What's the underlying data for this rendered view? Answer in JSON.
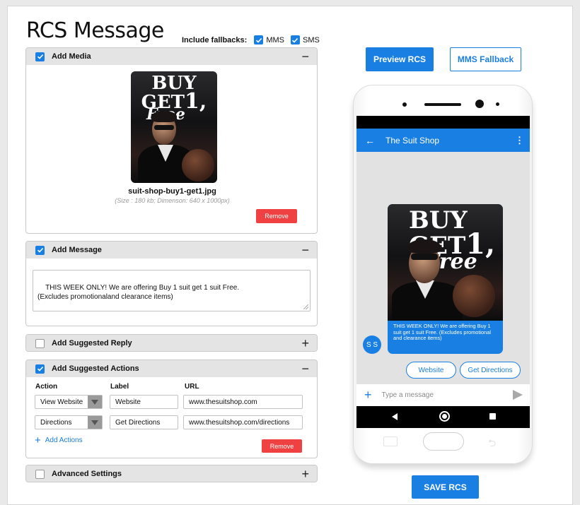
{
  "title": "RCS Message",
  "fallbacks": {
    "label": "Include fallbacks:",
    "mms": "MMS",
    "sms": "SMS"
  },
  "media": {
    "header": "Add Media",
    "toggle": "−",
    "filename": "suit-shop-buy1-get1.jpg",
    "filesize": "(Size : 180 kb; Dimenson: 640 x 1000px)",
    "remove": "Remove",
    "poster_line1": "BUY",
    "poster_line2": "GET",
    "poster_num": "1,",
    "poster_free": "Free"
  },
  "message": {
    "header": "Add Message",
    "toggle": "−",
    "text": "THIS WEEK ONLY! We are offering Buy 1 suit get 1 suit Free.\n(Excludes promotionaland clearance items)"
  },
  "suggested_reply": {
    "header": "Add Suggested Reply",
    "toggle": "+"
  },
  "suggested_actions": {
    "header": "Add Suggested Actions",
    "toggle": "−",
    "col_action": "Action",
    "col_label": "Label",
    "col_url": "URL",
    "rows": [
      {
        "action": "View Website",
        "label": "Website",
        "url": "www.thesuitshop.com"
      },
      {
        "action": "Directions",
        "label": "Get Directions",
        "url": "www.thesuitshop.com/directions"
      }
    ],
    "add_actions": "Add Actions",
    "remove": "Remove"
  },
  "advanced": {
    "header": "Advanced Settings",
    "toggle": "+"
  },
  "preview_rcs": "Preview RCS",
  "mms_fallback": "MMS Fallback",
  "save_rcs": "SAVE RCS",
  "phone": {
    "contact": "The Suit Shop",
    "bubble_text": "THIS WEEK ONLY! We are offering Buy 1 suit get 1 suit Free. (Excludes promotional and clearance items)",
    "avatar": "S S",
    "chip_website": "Website",
    "chip_directions": "Get Directions",
    "composer_placeholder": "Type a message"
  },
  "colors": {
    "accent": "#1a7fe3",
    "danger": "#ef4141",
    "panel_header": "#e4e4e4"
  }
}
